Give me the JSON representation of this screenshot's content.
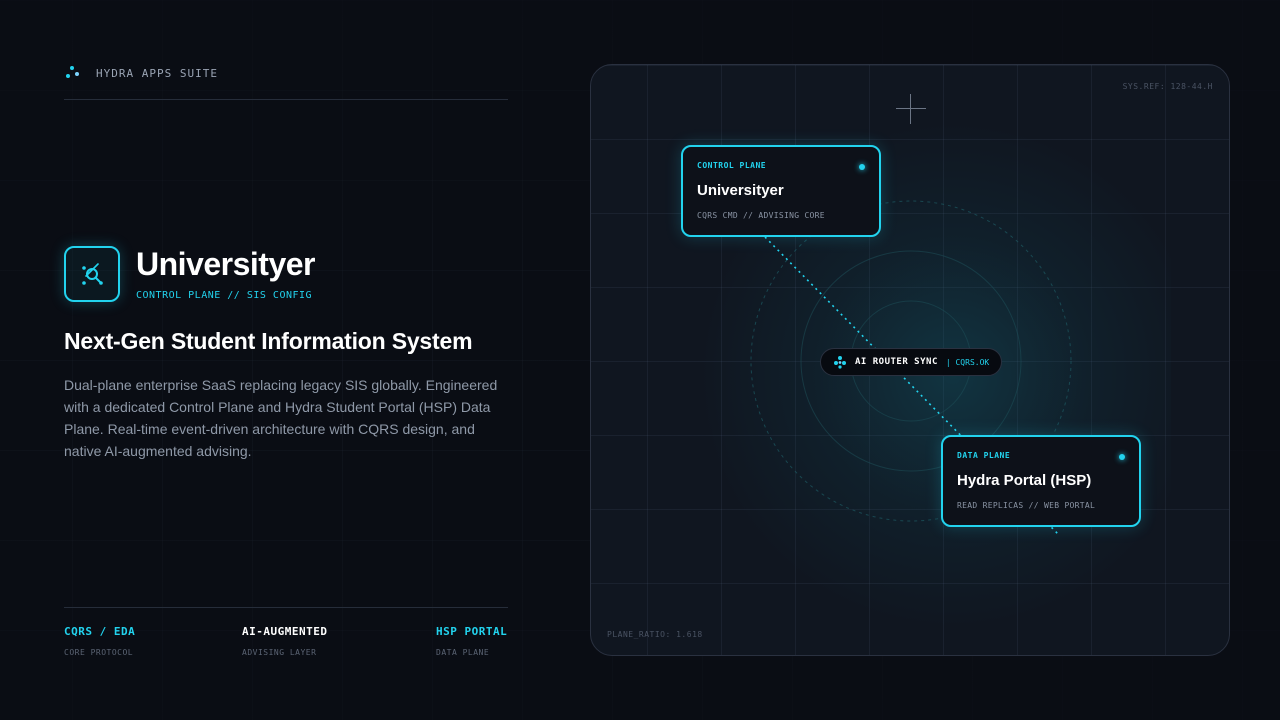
{
  "brand": {
    "name": "HYDRA APPS SUITE",
    "icon": "hydra-dots-icon"
  },
  "hero": {
    "title": "Universityer",
    "subtitle": "CONTROL PLANE // SIS CONFIG",
    "icon": "search-node-icon"
  },
  "tagline": "Next-Gen Student Information System",
  "description": "Dual-plane enterprise SaaS replacing legacy SIS globally. Engineered with a dedicated Control Plane and Hydra Student Portal (HSP) Data Plane. Real-time event-driven architecture with CQRS design, and native AI-augmented advising.",
  "stats": [
    {
      "value": "CQRS / EDA",
      "label": "CORE PROTOCOL",
      "color": "#22d3ee"
    },
    {
      "value": "AI-AUGMENTED",
      "label": "ADVISING LAYER",
      "color": "#ffffff"
    },
    {
      "value": "HSP PORTAL",
      "label": "DATA PLANE",
      "color": "#22d3ee"
    }
  ],
  "diagram": {
    "sys_ref": "SYS.REF: 128-44.H",
    "plane_ratio": "PLANE_RATIO: 1.618",
    "control_card": {
      "tag": "CONTROL PLANE",
      "title": "Universityer",
      "sub": "CQRS CMD // ADVISING CORE"
    },
    "data_card": {
      "tag": "DATA PLANE",
      "title": "Hydra Portal (HSP)",
      "sub": "READ REPLICAS // WEB PORTAL"
    },
    "router": {
      "label": "AI ROUTER SYNC",
      "status": "| CQRS.OK",
      "icon": "sparkle-icon"
    }
  },
  "colors": {
    "accent": "#22d3ee",
    "background": "#0a0d14",
    "panel": "#101620"
  }
}
